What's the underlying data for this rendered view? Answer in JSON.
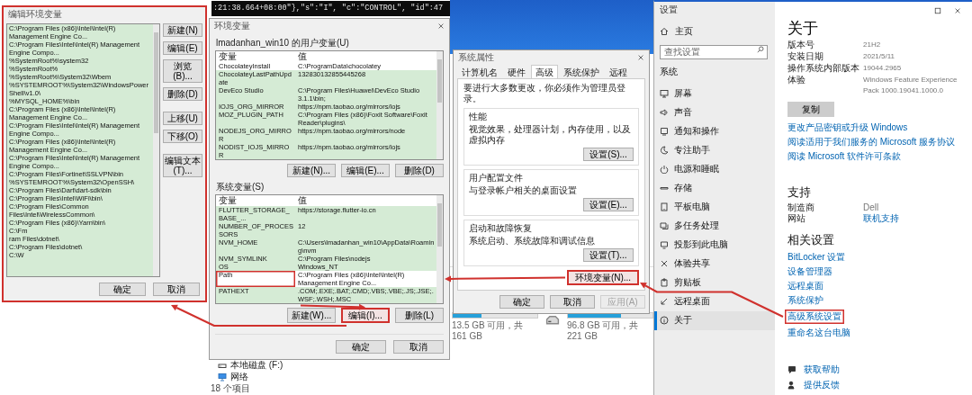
{
  "code_strip": {
    "text": ":21:38.664+08:00\"},\"s\":\"I\", \"c\":\"CONTROL\", \"id\":47"
  },
  "edit_dialog": {
    "title": "编辑环境变量",
    "highlighted": true,
    "paths": [
      "C:\\Program Files (x86)\\Intel\\Intel(R) Management Engine Co...",
      "C:\\Program Files\\Intel\\Intel(R) Management Engine Compo...",
      "%SystemRoot%\\system32",
      "%SystemRoot%",
      "%SystemRoot%\\System32\\Wbem",
      "%SYSTEMROOT%\\System32\\WindowsPowerShell\\v1.0\\",
      "%MYSQL_HOME%\\bin",
      "C:\\Program Files (x86)\\Intel\\Intel(R) Management Engine Co...",
      "C:\\Program Files\\Intel\\Intel(R) Management Engine Compo...",
      "C:\\Program Files (x86)\\Intel\\Intel(R) Management Engine Co...",
      "C:\\Program Files\\Intel\\Intel(R) Management Engine Compo...",
      "C:\\Program Files\\Fortinet\\SSLVPN\\bin",
      "%SYSTEMROOT%\\System32\\OpenSSH\\",
      "C:\\Program Files\\Dart\\dart-sdk\\bin",
      "C:\\Program Files\\Intel\\WiFi\\bin\\",
      "C:\\Program Files\\Common Files\\Intel\\WirelessCommon\\",
      "C:\\Program Files (x86)\\Yarn\\bin\\",
      "C:\\Fm",
      "ram Files\\dotnet\\",
      "C:\\Program Files\\dotnet\\",
      "C:\\W"
    ],
    "button_groups": [
      [
        {
          "label": "新建(N)"
        },
        {
          "label": "编辑(E)"
        },
        {
          "label": "浏览(B)..."
        },
        {
          "label": "删除(D)"
        }
      ],
      [
        {
          "label": "上移(U)"
        },
        {
          "label": "下移(O)"
        }
      ],
      [
        {
          "label": "编辑文本(T)..."
        }
      ]
    ],
    "footer_buttons": [
      {
        "label": "确定"
      },
      {
        "label": "取消"
      }
    ]
  },
  "env_dialog": {
    "title": "环境变量",
    "user_section": {
      "label": "lmadanhan_win10 的用户变量(U)",
      "columns": [
        "变量",
        "值"
      ],
      "rows": [
        {
          "name": "ChocolateyInstall",
          "value": "C:\\ProgramData\\chocolatey",
          "selected": true,
          "highlighted": false
        },
        {
          "name": "ChocolateyLastPathUpdate",
          "value": "132830132855445268",
          "selected": false,
          "highlighted": false
        },
        {
          "name": "DevEco Studio",
          "value": "C:\\Program Files\\Huawei\\DevEco Studio 3.1.1\\bin;",
          "selected": false,
          "highlighted": false
        },
        {
          "name": "IOJS_ORG_MIRROR",
          "value": "https://npm.taobao.org/mirrors/iojs",
          "selected": false,
          "highlighted": false
        },
        {
          "name": "MOZ_PLUGIN_PATH",
          "value": "C:\\Program Files (x86)\\Foxit Software\\Foxit Reader\\plugins\\",
          "selected": false,
          "highlighted": false
        },
        {
          "name": "NODEJS_ORG_MIRROR",
          "value": "https://npm.taobao.org/mirrors/node",
          "selected": false,
          "highlighted": false
        },
        {
          "name": "NODIST_IOJS_MIRROR",
          "value": "https://npm.taobao.org/mirrors/iojs",
          "selected": false,
          "highlighted": false
        }
      ],
      "buttons": [
        {
          "label": "新建(N)...",
          "highlighted": false
        },
        {
          "label": "编辑(E)...",
          "highlighted": false
        },
        {
          "label": "删除(D)",
          "highlighted": false
        }
      ]
    },
    "system_section": {
      "label": "系统变量(S)",
      "columns": [
        "变量",
        "值"
      ],
      "rows": [
        {
          "name": "FLUTTER_STORAGE_BASE_...",
          "value": "https://storage.flutter-io.cn",
          "selected": false,
          "highlighted": false
        },
        {
          "name": "NUMBER_OF_PROCESSORS",
          "value": "12",
          "selected": false,
          "highlighted": false
        },
        {
          "name": "NVM_HOME",
          "value": "C:\\Users\\lmadanhan_win10\\AppData\\Roaming\\nvm",
          "selected": false,
          "highlighted": false
        },
        {
          "name": "NVM_SYMLINK",
          "value": "C:\\Program Files\\nodejs",
          "selected": false,
          "highlighted": false
        },
        {
          "name": "OS",
          "value": "Windows_NT",
          "selected": false,
          "highlighted": false
        },
        {
          "name": "Path",
          "value": "C:\\Program Files (x86)\\Intel\\Intel(R) Management Engine Co...",
          "selected": true,
          "highlighted": true
        },
        {
          "name": "PATHEXT",
          "value": ".COM;.EXE;.BAT;.CMD;.VBS;.VBE;.JS;.JSE;.WSF;.WSH;.MSC",
          "selected": false,
          "highlighted": false
        }
      ],
      "buttons": [
        {
          "label": "新建(W)...",
          "highlighted": false
        },
        {
          "label": "编辑(I)...",
          "highlighted": true
        },
        {
          "label": "删除(L)",
          "highlighted": false
        }
      ]
    },
    "footer_buttons": [
      {
        "label": "确定"
      },
      {
        "label": "取消"
      }
    ]
  },
  "system_properties": {
    "title": "系统属性",
    "tabs": [
      {
        "label": "计算机名",
        "selected": false
      },
      {
        "label": "硬件",
        "selected": false
      },
      {
        "label": "高级",
        "selected": true
      },
      {
        "label": "系统保护",
        "selected": false
      },
      {
        "label": "远程",
        "selected": false
      }
    ],
    "notice": "要进行大多数更改，你必须作为管理员登录。",
    "groups": [
      {
        "title": "性能",
        "description": "视觉效果，处理器计划，内存使用，以及虚拟内存",
        "button": "设置(S)..."
      },
      {
        "title": "用户配置文件",
        "description": "与登录帐户相关的桌面设置",
        "button": "设置(E)..."
      },
      {
        "title": "启动和故障恢复",
        "description": "系统启动、系统故障和调试信息",
        "button": "设置(T)..."
      }
    ],
    "env_button": {
      "label": "环境变量(N)...",
      "highlighted": true
    },
    "footer_buttons": [
      {
        "label": "确定",
        "disabled": false
      },
      {
        "label": "取消",
        "disabled": false
      },
      {
        "label": "应用(A)",
        "disabled": true
      }
    ]
  },
  "explorer": {
    "drives": [
      {
        "space": "13.5 GB 可用，共 161 GB",
        "level": 0.34
      },
      {
        "space": "96.8 GB 可用，共 221 GB",
        "level": 0.63
      }
    ],
    "nav_items": [
      {
        "label": "本地磁盘 (F:)",
        "kind": "drive"
      },
      {
        "label": "网络",
        "kind": "network"
      }
    ],
    "status": "18 个项目"
  },
  "settings": {
    "title": "设置",
    "home": "主页",
    "search_placeholder": "查找设置",
    "section": "系统",
    "nav": [
      {
        "label": "屏幕",
        "kind": "monitor",
        "selected": false
      },
      {
        "label": "声音",
        "kind": "speaker",
        "selected": false
      },
      {
        "label": "通知和操作",
        "kind": "notification",
        "selected": false
      },
      {
        "label": "专注助手",
        "kind": "moon",
        "selected": false
      },
      {
        "label": "电源和睡眠",
        "kind": "power",
        "selected": false
      },
      {
        "label": "存储",
        "kind": "storage",
        "selected": false
      },
      {
        "label": "平板电脑",
        "kind": "tablet",
        "selected": false
      },
      {
        "label": "多任务处理",
        "kind": "multitask",
        "selected": false
      },
      {
        "label": "投影到此电脑",
        "kind": "project",
        "selected": false
      },
      {
        "label": "体验共享",
        "kind": "shared",
        "selected": false
      },
      {
        "label": "剪贴板",
        "kind": "clipboard",
        "selected": false
      },
      {
        "label": "远程桌面",
        "kind": "remote",
        "selected": false
      },
      {
        "label": "关于",
        "kind": "info",
        "selected": true
      }
    ],
    "page_title": "关于",
    "specs": [
      {
        "label": "版本号",
        "value": "21H2"
      },
      {
        "label": "安装日期",
        "value": "2021/5/11"
      },
      {
        "label": "操作系统内部版本",
        "value": "19044.2965"
      },
      {
        "label": "体验",
        "value": "Windows Feature Experience Pack 1000.19041.1000.0"
      }
    ],
    "copy_button": "复制",
    "links": [
      "更改产品密钥或升级 Windows",
      "阅读适用于我们服务的 Microsoft 服务协议",
      "阅读 Microsoft 软件许可条款"
    ],
    "support_title": "支持",
    "support": [
      {
        "label": "制造商",
        "value": "Dell",
        "kind": "text"
      },
      {
        "label": "网站",
        "value": "联机支持",
        "kind": "link"
      }
    ],
    "related_title": "相关设置",
    "related": [
      {
        "label": "BitLocker 设置",
        "highlighted": false
      },
      {
        "label": "设备管理器",
        "highlighted": false
      },
      {
        "label": "远程桌面",
        "highlighted": false
      },
      {
        "label": "系统保护",
        "highlighted": false
      },
      {
        "label": "高级系统设置",
        "highlighted": true
      },
      {
        "label": "重命名这台电脑",
        "highlighted": false
      }
    ],
    "footer_links": [
      {
        "label": "获取帮助",
        "kind": "help"
      },
      {
        "label": "提供反馈",
        "kind": "feedback"
      }
    ]
  }
}
